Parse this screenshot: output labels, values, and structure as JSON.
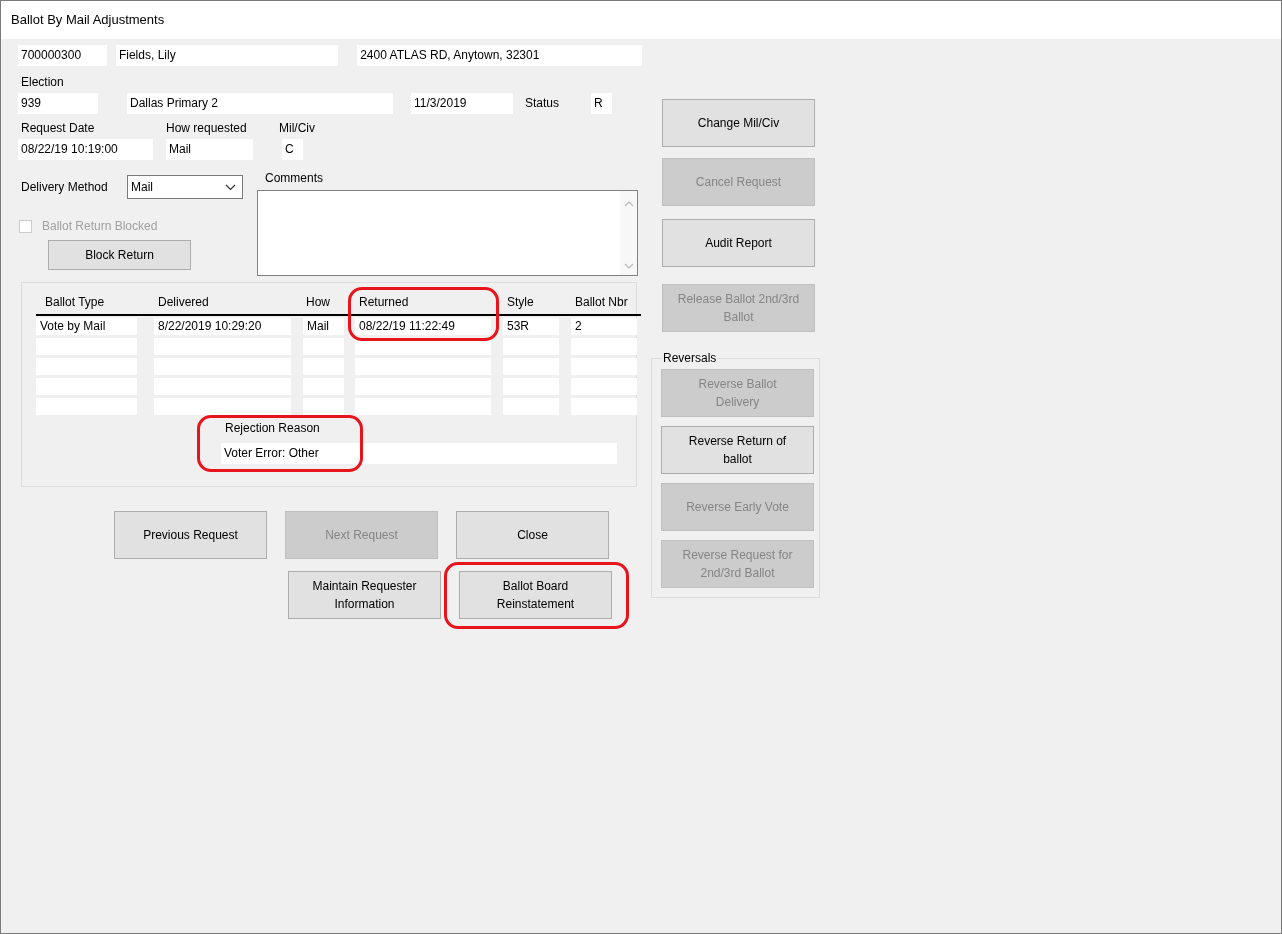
{
  "window": {
    "title": "Ballot By Mail Adjustments"
  },
  "voter": {
    "id": "700000300",
    "name": "Fields, Lily",
    "address": "2400 ATLAS RD, Anytown, 32301"
  },
  "election": {
    "label": "Election",
    "number": "939",
    "name": "Dallas Primary 2",
    "date": "11/3/2019",
    "status_label": "Status",
    "status": "R"
  },
  "request": {
    "date_label": "Request Date",
    "date": "08/22/19 10:19:00",
    "how_label": "How requested",
    "how": "Mail",
    "milciv_label": "Mil/Civ",
    "milciv": "C"
  },
  "delivery": {
    "label": "Delivery Method",
    "value": "Mail"
  },
  "comments": {
    "label": "Comments"
  },
  "return_blocked": {
    "label": "Ballot Return Blocked",
    "checked": false,
    "disabled": true
  },
  "block_button": {
    "label": "Block Return",
    "disabled": false
  },
  "ballots": {
    "columns": [
      {
        "label": "Ballot Type",
        "highlighted": false
      },
      {
        "label": "Delivered",
        "highlighted": false
      },
      {
        "label": "How",
        "highlighted": false
      },
      {
        "label": "Returned",
        "highlighted": true
      },
      {
        "label": "Style",
        "highlighted": false
      },
      {
        "label": "Ballot Nbr",
        "highlighted": false
      }
    ],
    "rows": [
      [
        "Vote by Mail",
        "8/22/2019 10:29:20",
        "Mail",
        "08/22/19 11:22:49",
        "53R",
        "2"
      ]
    ]
  },
  "rejection": {
    "label": "Rejection Reason",
    "value": "Voter Error: Other",
    "highlighted": true
  },
  "nav_buttons": [
    {
      "label": "Previous Request",
      "disabled": false,
      "highlighted": false
    },
    {
      "label": "Next Request",
      "disabled": true,
      "highlighted": false
    },
    {
      "label": "Close",
      "disabled": false,
      "highlighted": false
    }
  ],
  "extra_buttons": [
    {
      "label": "Maintain Requester Information",
      "disabled": false,
      "highlighted": false
    },
    {
      "label": "Ballot Board Reinstatement",
      "disabled": false,
      "highlighted": true
    }
  ],
  "side_buttons": [
    {
      "label": "Change Mil/Civ",
      "disabled": false
    },
    {
      "label": "Cancel Request",
      "disabled": true
    },
    {
      "label": "Audit Report",
      "disabled": false
    },
    {
      "label": "Release Ballot 2nd/3rd Ballot",
      "disabled": true
    }
  ],
  "reversals": {
    "title": "Reversals",
    "buttons": [
      {
        "label": "Reverse Ballot Delivery",
        "disabled": true
      },
      {
        "label": "Reverse Return of ballot",
        "disabled": false
      },
      {
        "label": "Reverse Early Vote",
        "disabled": true
      },
      {
        "label": "Reverse Request for 2nd/3rd Ballot",
        "disabled": true
      }
    ]
  }
}
